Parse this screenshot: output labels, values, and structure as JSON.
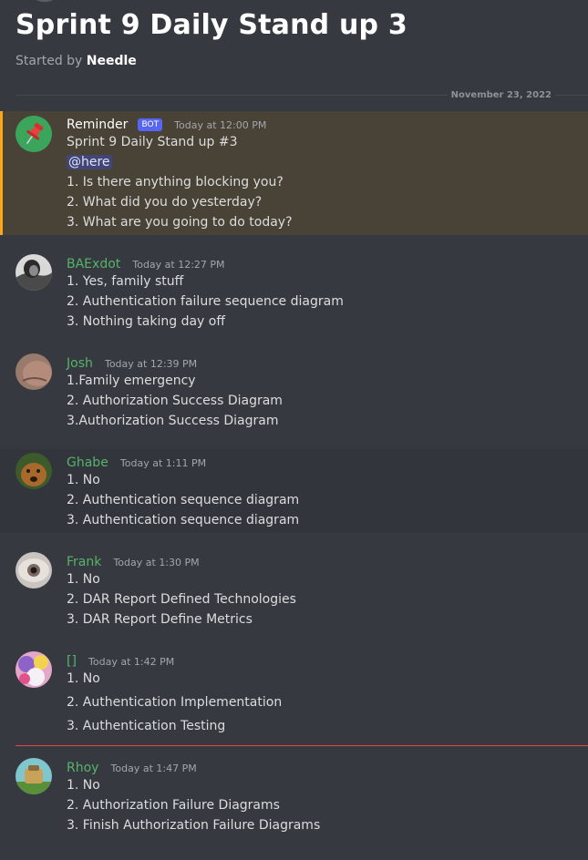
{
  "thread": {
    "title": "Sprint 9 Daily Stand up 3",
    "started_by_prefix": "Started by",
    "started_by_author": "Needle"
  },
  "date_divider": "November 23, 2022",
  "messages": [
    {
      "author": "Reminder",
      "author_color": "#ffffff",
      "bot_tag": "BOT",
      "timestamp": "Today at 12:00 PM",
      "lines": [
        "Sprint 9 Daily Stand up #3",
        "@here",
        "1. Is there anything blocking you?",
        "2. What did you do yesterday?",
        "3. What are you going to do today?"
      ]
    },
    {
      "author": "BAExdot",
      "author_color": "#57b36a",
      "timestamp": "Today at 12:27 PM",
      "lines": [
        "1. Yes, family stuff",
        "2. Authentication failure sequence diagram",
        "3. Nothing taking day off"
      ]
    },
    {
      "author": "Josh",
      "author_color": "#57b36a",
      "timestamp": "Today at 12:39 PM",
      "lines": [
        "1.Family emergency",
        "2. Authorization Success Diagram",
        "3.Authorization Success Diagram"
      ]
    },
    {
      "author": "Ghabe",
      "author_color": "#57b36a",
      "timestamp": "Today at 1:11 PM",
      "lines": [
        "1. No",
        "2. Authentication sequence diagram",
        "3. Authentication sequence diagram"
      ]
    },
    {
      "author": "Frank",
      "author_color": "#57b36a",
      "timestamp": "Today at 1:30 PM",
      "lines": [
        "1. No",
        "2. DAR Report Defined Technologies",
        "3. DAR Report Define Metrics"
      ]
    },
    {
      "author": "[]",
      "author_color": "#57b36a",
      "timestamp": "Today at 1:42 PM",
      "lines": [
        "1. No",
        "2. Authentication Implementation",
        "3. Authentication Testing"
      ]
    },
    {
      "author": "Rhoy",
      "author_color": "#57b36a",
      "timestamp": "Today at 1:47 PM",
      "lines": [
        "1. No",
        "2. Authorization Failure Diagrams",
        "3. Finish Authorization Failure Diagrams"
      ]
    }
  ],
  "colors": {
    "background": "#36393f",
    "mention_highlight": "#494236",
    "mention_bar": "#faa81a",
    "new_messages_line": "#ed4245",
    "bot_tag": "#5865f2"
  },
  "icons": [
    "pushpin-icon"
  ]
}
